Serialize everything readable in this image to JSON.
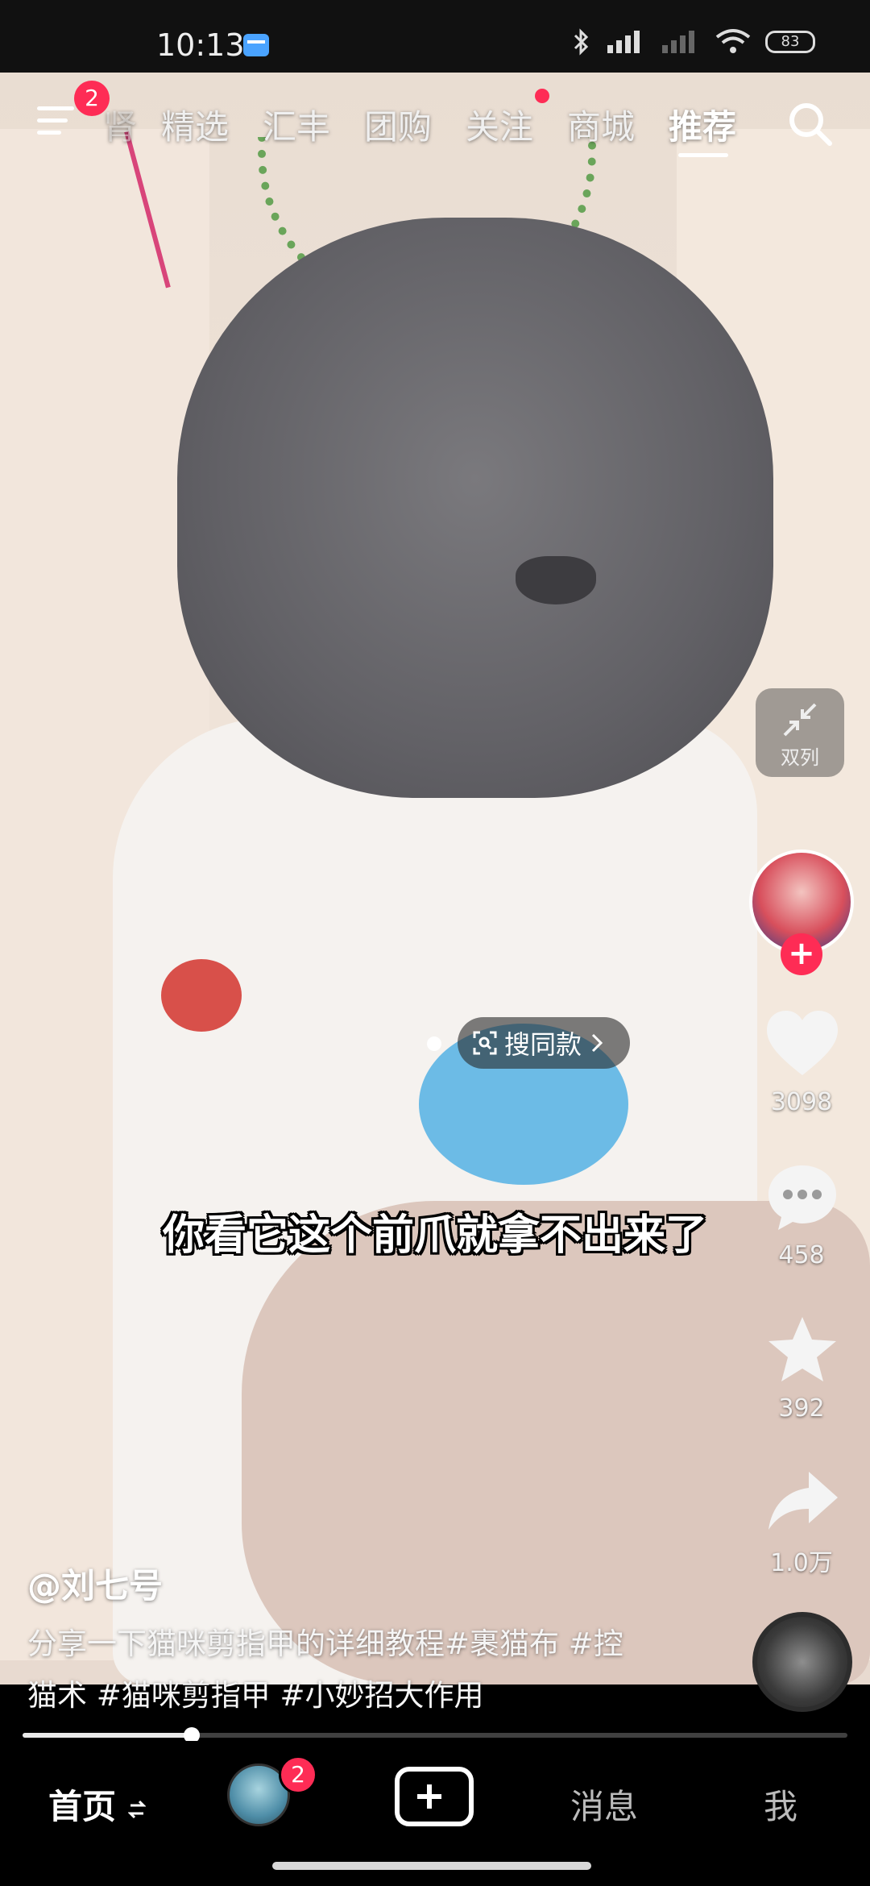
{
  "status_bar": {
    "time": "10:13",
    "battery": "83",
    "icons": [
      "app-notification-icon",
      "bluetooth-icon",
      "hd-signal-icon",
      "no-signal-icon",
      "wifi-icon",
      "battery-icon"
    ]
  },
  "top_nav": {
    "menu_badge": "2",
    "tabs": [
      "肾",
      "精选",
      "汇丰",
      "团购",
      "关注",
      "商城",
      "推荐"
    ],
    "active_tab": "推荐",
    "follow_has_dot": true
  },
  "video": {
    "search_same_label": "搜同款",
    "subtitle": "你看它这个前爪就拿不出来了"
  },
  "right_rail": {
    "dual_column_label": "双列",
    "likes": "3098",
    "comments": "458",
    "favorites": "392",
    "shares": "1.0万"
  },
  "caption": {
    "author": "@刘七号",
    "text_line1": "分享一下猫咪剪指甲的详细教程#裹猫布 #控",
    "text_line2": "猫术 #猫咪剪指甲 #小妙招大作用"
  },
  "progress": {
    "fraction": 0.205
  },
  "bottom_nav": {
    "home": "首页",
    "friend_badge": "2",
    "messages": "消息",
    "me": "我"
  },
  "colors": {
    "accent": "#fe2c55",
    "background": "#000000"
  }
}
